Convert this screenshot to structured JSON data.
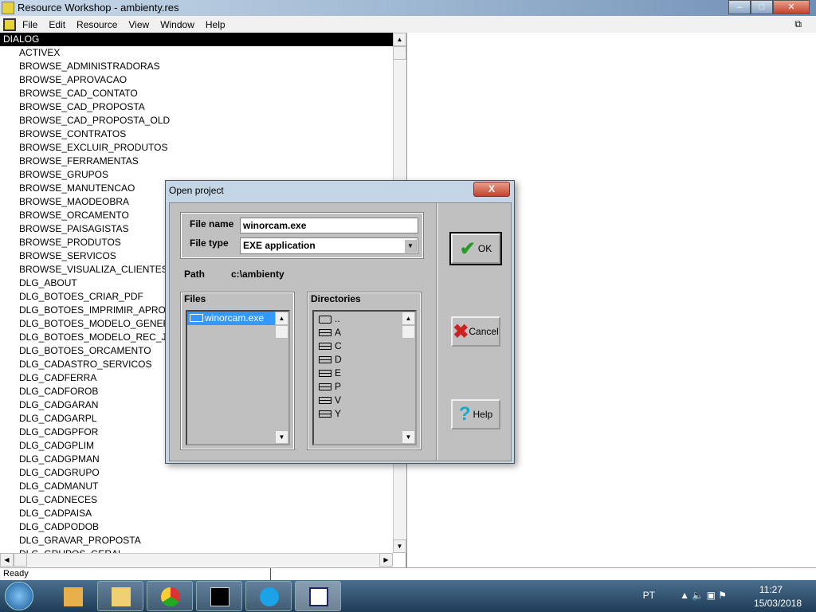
{
  "window": {
    "title": "Resource Workshop - ambienty.res",
    "controls": [
      "–",
      "□",
      "✕"
    ]
  },
  "menu": [
    "File",
    "Edit",
    "Resource",
    "View",
    "Window",
    "Help"
  ],
  "list": {
    "header": "DIALOG",
    "items": [
      "ACTIVEX",
      "BROWSE_ADMINISTRADORAS",
      "BROWSE_APROVACAO",
      "BROWSE_CAD_CONTATO",
      "BROWSE_CAD_PROPOSTA",
      "BROWSE_CAD_PROPOSTA_OLD",
      "BROWSE_CONTRATOS",
      "BROWSE_EXCLUIR_PRODUTOS",
      "BROWSE_FERRAMENTAS",
      "BROWSE_GRUPOS",
      "BROWSE_MANUTENCAO",
      "BROWSE_MAODEOBRA",
      "BROWSE_ORCAMENTO",
      "BROWSE_PAISAGISTAS",
      "BROWSE_PRODUTOS",
      "BROWSE_SERVICOS",
      "BROWSE_VISUALIZA_CLIENTES",
      "DLG_ABOUT",
      "DLG_BOTOES_CRIAR_PDF",
      "DLG_BOTOES_IMPRIMIR_APROVADO",
      "DLG_BOTOES_MODELO_GENERICO",
      "DLG_BOTOES_MODELO_REC_JARDIM",
      "DLG_BOTOES_ORCAMENTO",
      "DLG_CADASTRO_SERVICOS",
      "DLG_CADFERRA",
      "DLG_CADFOROB",
      "DLG_CADGARAN",
      "DLG_CADGARPL",
      "DLG_CADGPFOR",
      "DLG_CADGPLIM",
      "DLG_CADGPMAN",
      "DLG_CADGRUPO",
      "DLG_CADMANUT",
      "DLG_CADNECES",
      "DLG_CADPAISA",
      "DLG_CADPODOB",
      "DLG_GRAVAR_PROPOSTA",
      "DLG_GRUPOS_GERAL"
    ]
  },
  "status": "Ready",
  "dialog": {
    "title": "Open project",
    "close": "X",
    "file_name_label": "File name",
    "file_name": "winorcam.exe",
    "file_type_label": "File type",
    "file_type": "EXE  application",
    "path_label": "Path",
    "path": "c:\\ambienty",
    "files_label": "Files",
    "files": [
      "winorcam.exe"
    ],
    "dirs_label": "Directories",
    "dirs": [
      "..",
      "A",
      "C",
      "D",
      "E",
      "P",
      "V",
      "Y"
    ],
    "ok": "OK",
    "cancel": "Cancel",
    "help": "Help"
  },
  "tray": {
    "lang": "PT",
    "time": "11:27",
    "date": "15/03/2018"
  }
}
